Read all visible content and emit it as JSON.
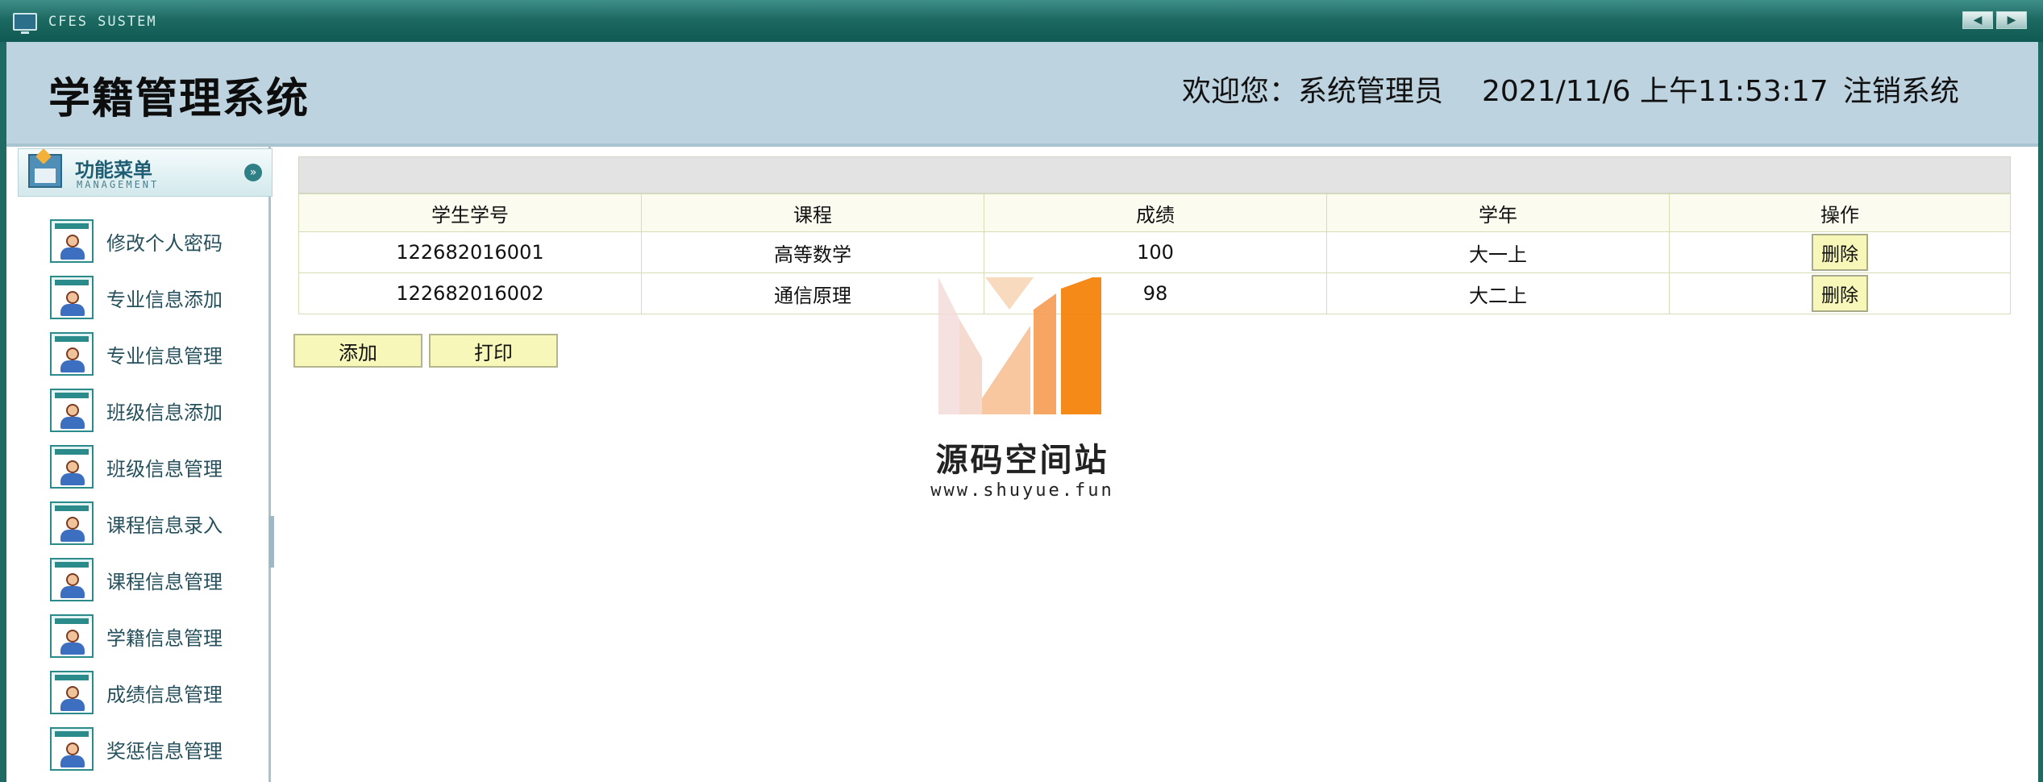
{
  "window": {
    "title": "CFES SUSTEM"
  },
  "header": {
    "system_title": "学籍管理系统",
    "welcome": "欢迎您：系统管理员",
    "datetime": "2021/11/6 上午11:53:17",
    "logout": "注销系统"
  },
  "sidebar": {
    "menu_title": "功能菜单",
    "menu_subtitle": "MANAGEMENT",
    "items": [
      {
        "label": "修改个人密码"
      },
      {
        "label": "专业信息添加"
      },
      {
        "label": "专业信息管理"
      },
      {
        "label": "班级信息添加"
      },
      {
        "label": "班级信息管理"
      },
      {
        "label": "课程信息录入"
      },
      {
        "label": "课程信息管理"
      },
      {
        "label": "学籍信息管理"
      },
      {
        "label": "成绩信息管理"
      },
      {
        "label": "奖惩信息管理"
      }
    ]
  },
  "table": {
    "columns": [
      "学生学号",
      "课程",
      "成绩",
      "学年",
      "操作"
    ],
    "rows": [
      {
        "student_id": "122682016001",
        "course": "高等数学",
        "score": "100",
        "year": "大一上",
        "action": "删除"
      },
      {
        "student_id": "122682016002",
        "course": "通信原理",
        "score": "98",
        "year": "大二上",
        "action": "删除"
      }
    ]
  },
  "actions": {
    "add": "添加",
    "print": "打印"
  },
  "watermark": {
    "name": "源码空间站",
    "url": "www.shuyue.fun"
  },
  "colors": {
    "titlebar": "#1d6a62",
    "header_bg": "#bdd3df",
    "button_bg": "#f6f7b9",
    "watermark_orange": "#f5840c"
  }
}
